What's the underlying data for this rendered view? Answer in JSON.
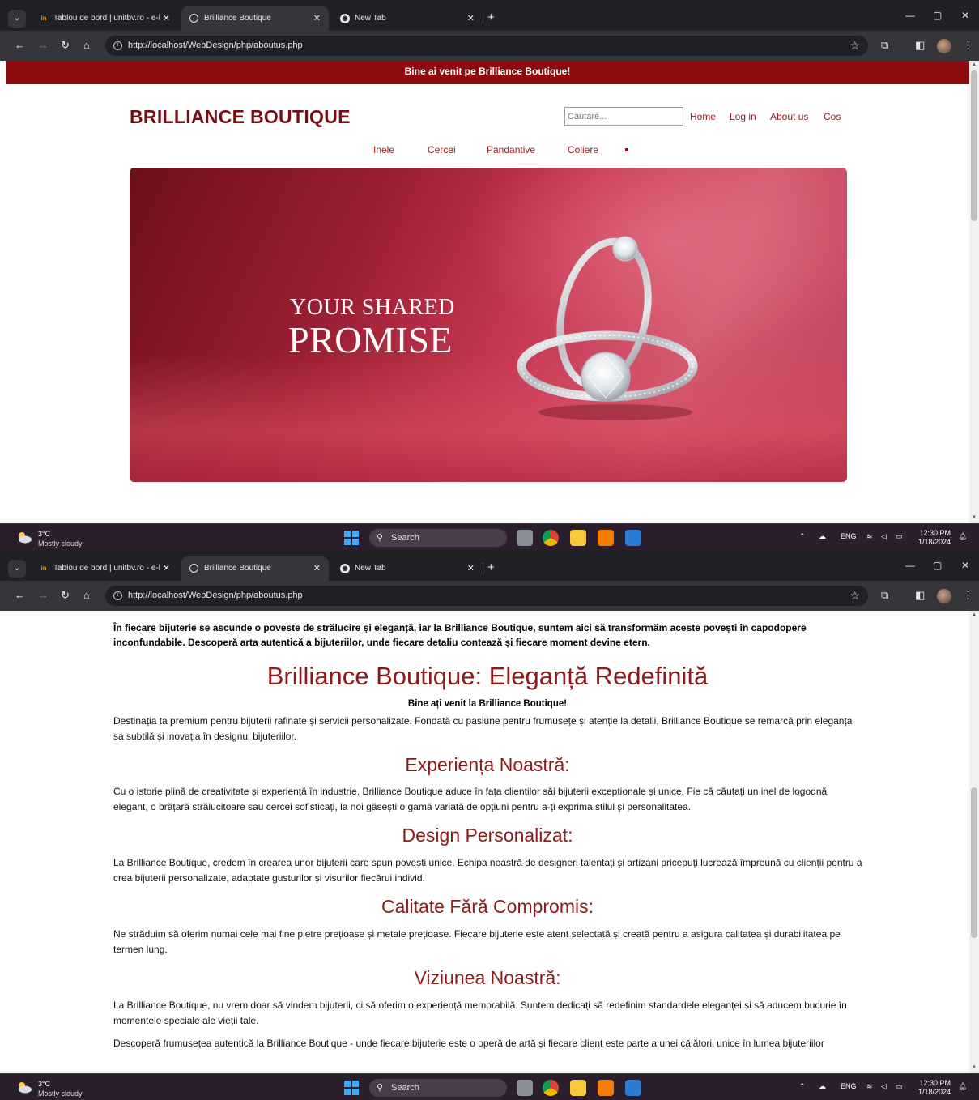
{
  "browser": {
    "tabs": [
      {
        "title": "Tablou de bord | unitbv.ro - e-l"
      },
      {
        "title": "Brilliance Boutique"
      },
      {
        "title": "New Tab"
      }
    ],
    "url": "http://localhost/WebDesign/php/aboutus.php"
  },
  "taskbar": {
    "temp": "3°C",
    "weather": "Mostly cloudy",
    "search": "Search",
    "lang": "ENG",
    "time": "12:30 PM",
    "date": "1/18/2024"
  },
  "site": {
    "welcome": "Bine ai venit pe Brilliance Boutique!",
    "brand": "BRILLIANCE BOUTIQUE",
    "search_placeholder": "Cautare...",
    "nav": [
      "Home",
      "Log in",
      "About us",
      "Cos"
    ],
    "categories": [
      "Inele",
      "Cercei",
      "Pandantive",
      "Coliere"
    ],
    "hero": {
      "line1": "YOUR SHARED",
      "line2": "PROMISE"
    }
  },
  "about": {
    "intro": "În fiecare bijuterie se ascunde o poveste de strălucire și eleganță, iar la Brilliance Boutique, suntem aici să transformăm aceste povești în capodopere inconfundabile. Descoperă arta autentică a bijuteriilor, unde fiecare detaliu contează și fiecare moment devine etern.",
    "title": "Brilliance Boutique: Eleganță Redefinită",
    "subtitle": "Bine ați venit la Brilliance Boutique!",
    "p1": "Destinația ta premium pentru bijuterii rafinate și servicii personalizate. Fondată cu pasiune pentru frumusețe și atenție la detalii, Brilliance Boutique se remarcă prin eleganța sa subtilă și inovația în designul bijuteriilor.",
    "h_exp": "Experiența Noastră:",
    "p_exp": "Cu o istorie plină de creativitate și experiență în industrie, Brilliance Boutique aduce în fața clienților săi bijuterii excepționale și unice. Fie că căutați un inel de logodnă elegant, o brățară strălucitoare sau cercei sofisticați, la noi găsești o gamă variată de opțiuni pentru a-ți exprima stilul și personalitatea.",
    "h_design": "Design Personalizat:",
    "p_design": "La Brilliance Boutique, credem în crearea unor bijuterii care spun povești unice. Echipa noastră de designeri talentați și artizani pricepuți lucrează împreună cu clienții pentru a crea bijuterii personalizate, adaptate gusturilor și visurilor fiecărui individ.",
    "h_quality": "Calitate Fără Compromis:",
    "p_quality": "Ne străduim să oferim numai cele mai fine pietre prețioase și metale prețioase. Fiecare bijuterie este atent selectată și creată pentru a asigura calitatea și durabilitatea pe termen lung.",
    "h_vision": "Viziunea Noastră:",
    "p_vision": "La Brilliance Boutique, nu vrem doar să vindem bijuterii, ci să oferim o experiență memorabilă. Suntem dedicați să redefinim standardele eleganței și să aducem bucurie în momentele speciale ale vieții tale.",
    "p_final": "Descoperă frumusețea autentică la Brilliance Boutique - unde fiecare bijuterie este o operă de artă și fiecare client este parte a unei călătorii unice în lumea bijuteriilor"
  }
}
